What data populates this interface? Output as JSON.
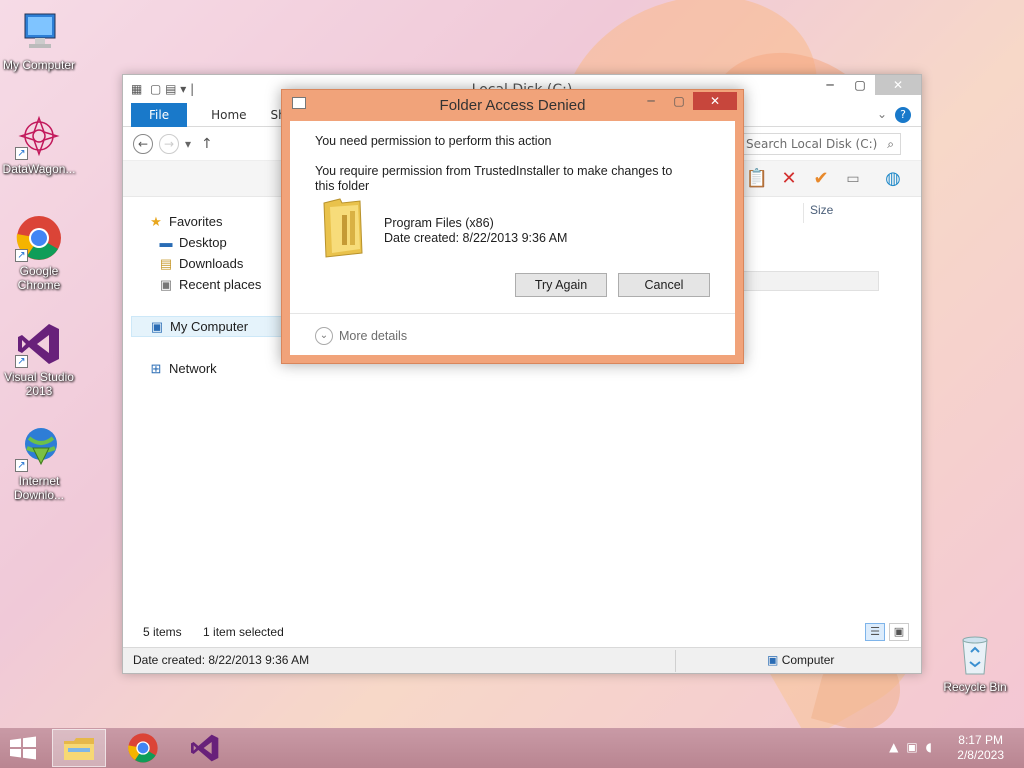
{
  "desktop": {
    "icons": [
      {
        "label": "My Computer"
      },
      {
        "label": "DataWagon..."
      },
      {
        "label": "Google Chrome"
      },
      {
        "label": "Visual Studio 2013"
      },
      {
        "label": "Internet Downlo..."
      },
      {
        "label": "Recycle Bin"
      }
    ]
  },
  "explorer": {
    "title": "Local Disk (C:)",
    "ribbon": {
      "file": "File",
      "home": "Home",
      "share": "Shar"
    },
    "search_placeholder": "Search Local Disk (C:)",
    "nav": {
      "favorites": "Favorites",
      "desktop": "Desktop",
      "downloads": "Downloads",
      "recent": "Recent places",
      "my_computer": "My Computer",
      "network": "Network"
    },
    "size_header": "Size",
    "status": {
      "items": "5 items",
      "selected": "1 item selected"
    },
    "details_bar": {
      "date_created": "Date created: 8/22/2013 9:36 AM",
      "location": "Computer"
    }
  },
  "dialog": {
    "title": "Folder Access Denied",
    "line1": "You need permission to perform this action",
    "line2": "You require permission from TrustedInstaller to make changes to this folder",
    "folder_name": "Program Files (x86)",
    "folder_date": "Date created: 8/22/2013 9:36 AM",
    "try_again": "Try Again",
    "cancel": "Cancel",
    "more_details": "More details"
  },
  "taskbar": {
    "time": "8:17 PM",
    "date": "2/8/2023"
  },
  "colors": {
    "dialog_frame": "#f1a37a",
    "close_red": "#c7463c",
    "file_tab_blue": "#1979ca"
  }
}
